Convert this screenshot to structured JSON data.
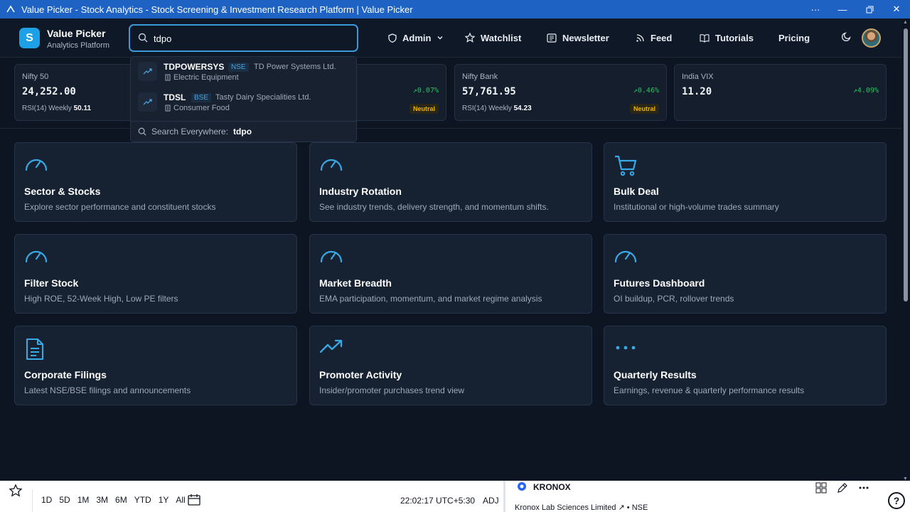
{
  "window": {
    "title": "Value Picker - Stock Analytics - Stock Screening & Investment Research Platform | Value Picker"
  },
  "brand": {
    "logo_letter": "S",
    "title": "Value Picker",
    "subtitle": "Analytics Platform"
  },
  "search": {
    "value": "tdpo"
  },
  "nav": {
    "admin": "Admin",
    "watchlist": "Watchlist",
    "newsletter": "Newsletter",
    "feed": "Feed",
    "tutorials": "Tutorials",
    "pricing": "Pricing"
  },
  "tickers": [
    {
      "name": "Nifty 50",
      "value": "24,252.00",
      "change": "",
      "rsi_label": "RSI(14) Weekly",
      "rsi_value": "50.11",
      "badge": ""
    },
    {
      "name": "",
      "value": "",
      "change": "0.07%",
      "rsi_label": "",
      "rsi_value": "",
      "badge": "Neutral"
    },
    {
      "name": "Nifty Bank",
      "value": "57,761.95",
      "change": "0.46%",
      "rsi_label": "RSI(14) Weekly",
      "rsi_value": "54.23",
      "badge": "Neutral"
    },
    {
      "name": "India VIX",
      "value": "11.20",
      "change": "4.09%",
      "rsi_label": "",
      "rsi_value": "",
      "badge": ""
    }
  ],
  "search_results": [
    {
      "symbol": "TDPOWERSYS",
      "exchange": "NSE",
      "company": "TD Power Systems Ltd.",
      "sector": "Electric Equipment"
    },
    {
      "symbol": "TDSL",
      "exchange": "BSE",
      "company": "Tasty Dairy Specialities Ltd.",
      "sector": "Consumer Food"
    }
  ],
  "search_everywhere": {
    "label": "Search Everywhere:",
    "query": "tdpo"
  },
  "cards": [
    {
      "title": "Sector & Stocks",
      "desc": "Explore sector performance and constituent stocks",
      "icon": "gauge-icon"
    },
    {
      "title": "Industry Rotation",
      "desc": "See industry trends, delivery strength, and momentum shifts.",
      "icon": "gauge-icon"
    },
    {
      "title": "Bulk Deal",
      "desc": "Institutional or high-volume trades summary",
      "icon": "cart-icon"
    },
    {
      "title": "Filter Stock",
      "desc": "High ROE, 52-Week High, Low PE filters",
      "icon": "gauge-icon"
    },
    {
      "title": "Market Breadth",
      "desc": "EMA participation, momentum, and market regime analysis",
      "icon": "gauge-icon"
    },
    {
      "title": "Futures Dashboard",
      "desc": "OI buildup, PCR, rollover trends",
      "icon": "gauge-icon"
    },
    {
      "title": "Corporate Filings",
      "desc": "Latest NSE/BSE filings and announcements",
      "icon": "document-icon"
    },
    {
      "title": "Promoter Activity",
      "desc": "Insider/promoter purchases trend view",
      "icon": "trending-up-icon"
    },
    {
      "title": "Quarterly Results",
      "desc": "Earnings, revenue & quarterly performance results",
      "icon": "dots-icon"
    }
  ],
  "bottom_bar": {
    "ranges": [
      "1D",
      "5D",
      "1M",
      "3M",
      "6M",
      "YTD",
      "1Y",
      "All"
    ],
    "clock": "22:02:17 UTC+5:30",
    "adj": "ADJ",
    "symbol": "KRONOX",
    "symbol_name": "Kronox Lab Sciences Limited",
    "symbol_exchange": "NSE",
    "help": "?"
  },
  "colors": {
    "accent": "#1ea0e6",
    "positive": "#22c55e",
    "neutral_badge": "#eab308",
    "background": "#0d1522"
  }
}
